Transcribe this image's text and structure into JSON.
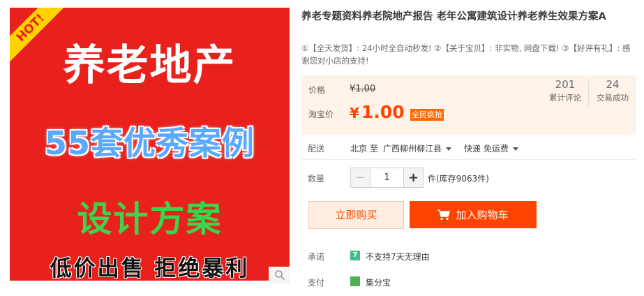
{
  "image": {
    "hot_badge": "HOT!",
    "line1": "养老地产",
    "line2": "55套优秀案例",
    "line3": "设计方案",
    "line4": "低价出售 拒绝暴利"
  },
  "product": {
    "title": "养老专题资料养老院地产报告 老年公寓建筑设计养老养生效果方案A",
    "subtitle": "①【全天发货】: 24小时全自动秒发! ②【关于宝贝】: 非实物, 网盘下载! ③【好评有礼】: 感谢您对小店的支持!"
  },
  "price": {
    "price_label": "价格",
    "original_price": "¥1.00",
    "taobao_label": "淘宝价",
    "currency": "¥",
    "taobao_price": "1.00",
    "promo_tag": "全民疯抢",
    "reviews_count": "201",
    "reviews_label": "累计评论",
    "deals_count": "24",
    "deals_label": "交易成功"
  },
  "delivery": {
    "label": "配送",
    "from": "北京 至",
    "to": "广西柳州柳江县",
    "shipping": "快递 免运费"
  },
  "quantity": {
    "label": "数量",
    "minus": "−",
    "value": "1",
    "plus": "+",
    "stock": "件(库存9063件)"
  },
  "actions": {
    "buy_now": "立即购买",
    "add_to_cart": "加入购物车"
  },
  "promise": {
    "label": "承诺",
    "icon_text": "7",
    "text": "不支持7天无理由"
  },
  "payment": {
    "label": "支付",
    "text": "集分宝"
  },
  "colors": {
    "accent": "#ff4400",
    "image_bg": "#e8211d",
    "panel_bg": "#fff2e8"
  }
}
